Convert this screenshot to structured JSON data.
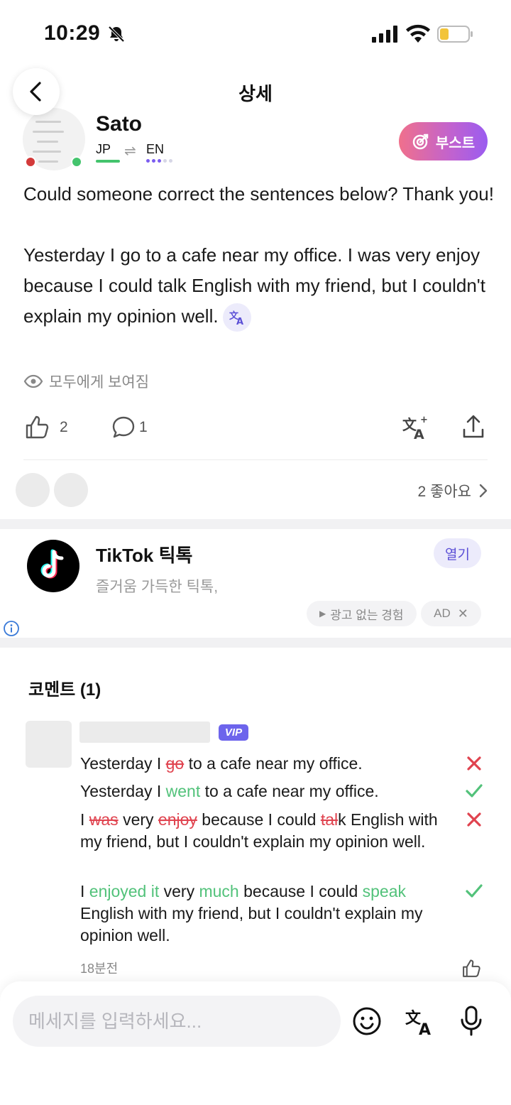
{
  "status_bar": {
    "time": "10:29"
  },
  "header": {
    "title": "상세"
  },
  "post": {
    "author": "Sato",
    "native_language": "JP",
    "learning_language": "EN",
    "boost_label": "부스트",
    "body": "Could someone correct the sentences below? Thank you!\n\nYesterday I go to a cafe near my office. I was very enjoy because I could talk English with my friend, but I couldn't explain my opinion well.",
    "visibility": "모두에게 보여짐",
    "like_count": "2",
    "comment_count": "1",
    "likes_summary": "2 좋아요"
  },
  "ad": {
    "title": "TikTok 틱톡",
    "description": "즐거움 가득한 틱톡,",
    "open_label": "열기",
    "no_ads_label": "광고 없는 경험",
    "ad_label": "AD"
  },
  "comments": {
    "title": "코멘트 (1)",
    "items": [
      {
        "badge": "VIP",
        "time": "18분전",
        "corrections": [
          {
            "original": {
              "p1": "Yesterday I ",
              "del1": "go",
              "p2": " to a cafe near my office."
            },
            "corrected": {
              "p1": "Yesterday I ",
              "ins1": "went",
              "p2": " to a cafe near my office."
            }
          },
          {
            "original": {
              "p1": " I ",
              "del1": "was",
              "p2": " very ",
              "del2": "enjoy",
              "p3": " because I could ",
              "del3": "tal",
              "p4": "k English with my friend, but I couldn't explain my opinion well."
            },
            "corrected": {
              "p1": " I ",
              "ins1": "enjoyed it",
              "p2": " very ",
              "ins2": "much",
              "p3": " because I could ",
              "ins3": "speak",
              "p4": " English with my friend, but I couldn't explain my opinion well."
            }
          }
        ]
      }
    ]
  },
  "composer": {
    "placeholder": "메세지를 입력하세요..."
  },
  "colors": {
    "accent": "#6d64ec",
    "deleted": "#e0434f",
    "inserted": "#52c27a",
    "boost_start": "#f0708c",
    "boost_end": "#9a5cf0"
  }
}
